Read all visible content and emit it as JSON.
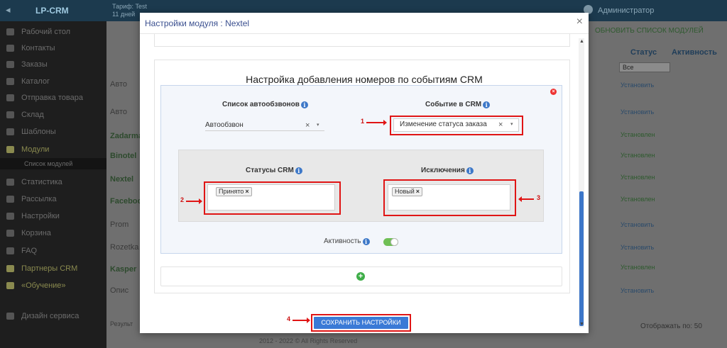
{
  "app": {
    "logo": "LP-CRM",
    "tariff_line1": "Тариф: Test",
    "tariff_line2": "11 дней",
    "admin": "Администратор"
  },
  "sidebar": {
    "items": [
      {
        "label": "Рабочий стол"
      },
      {
        "label": "Контакты"
      },
      {
        "label": "Заказы"
      },
      {
        "label": "Каталог"
      },
      {
        "label": "Отправка товара"
      },
      {
        "label": "Склад"
      },
      {
        "label": "Шаблоны"
      },
      {
        "label": "Модули"
      },
      {
        "label": "Список модулей"
      },
      {
        "label": "Статистика"
      },
      {
        "label": "Рассылка"
      },
      {
        "label": "Настройки"
      },
      {
        "label": "Корзина"
      },
      {
        "label": "FAQ"
      },
      {
        "label": "Партнеры CRM"
      },
      {
        "label": "«Обучение»"
      },
      {
        "label": "Дизайн сервиса"
      }
    ]
  },
  "background": {
    "refresh_label": "ОБНОВИТЬ СПИСОК МОДУЛЕЙ",
    "col_status": "Статус",
    "col_activity": "Активность",
    "status_filter": "Все",
    "rows": [
      "Авто",
      "Авто",
      "Zadarma",
      "Binotel",
      "Nextel",
      "Facebook",
      "Prom",
      "Rozetka",
      "Kasper",
      "Опис"
    ],
    "status_install": "Установить",
    "status_installed": "Установлен",
    "per_page_label": "Отображать по:",
    "per_page_value": "50",
    "results_label": "Результ",
    "copyright": "2012 - 2022 © All Rights Reserved"
  },
  "modal": {
    "title": "Настройки модуля : Nextel",
    "close_icon": "×",
    "section_title": "Настройка добавления номеров по событиям CRM",
    "autodial_list_label": "Список автообзвонов",
    "autodial_list_value": "Автообзвон",
    "crm_event_label": "Событие в CRM",
    "crm_event_value": "Изменение статуса заказа",
    "crm_statuses_label": "Статусы CRM",
    "crm_statuses_tags": [
      "Принято"
    ],
    "exceptions_label": "Исключения",
    "exceptions_tags": [
      "Новый"
    ],
    "activity_label": "Активность",
    "activity_enabled": true,
    "save_button": "Сохранить настройки",
    "info_glyph": "i",
    "clear_glyph": "×",
    "caret_glyph": "▾",
    "remove_glyph": "×",
    "add_glyph": "+"
  },
  "callouts": {
    "one": "1",
    "two": "2",
    "three": "3",
    "four": "4"
  },
  "colors": {
    "accent": "#3a7ad6",
    "highlight": "#e01515",
    "toggle_on": "#6fbf55",
    "add": "#3fae49"
  }
}
